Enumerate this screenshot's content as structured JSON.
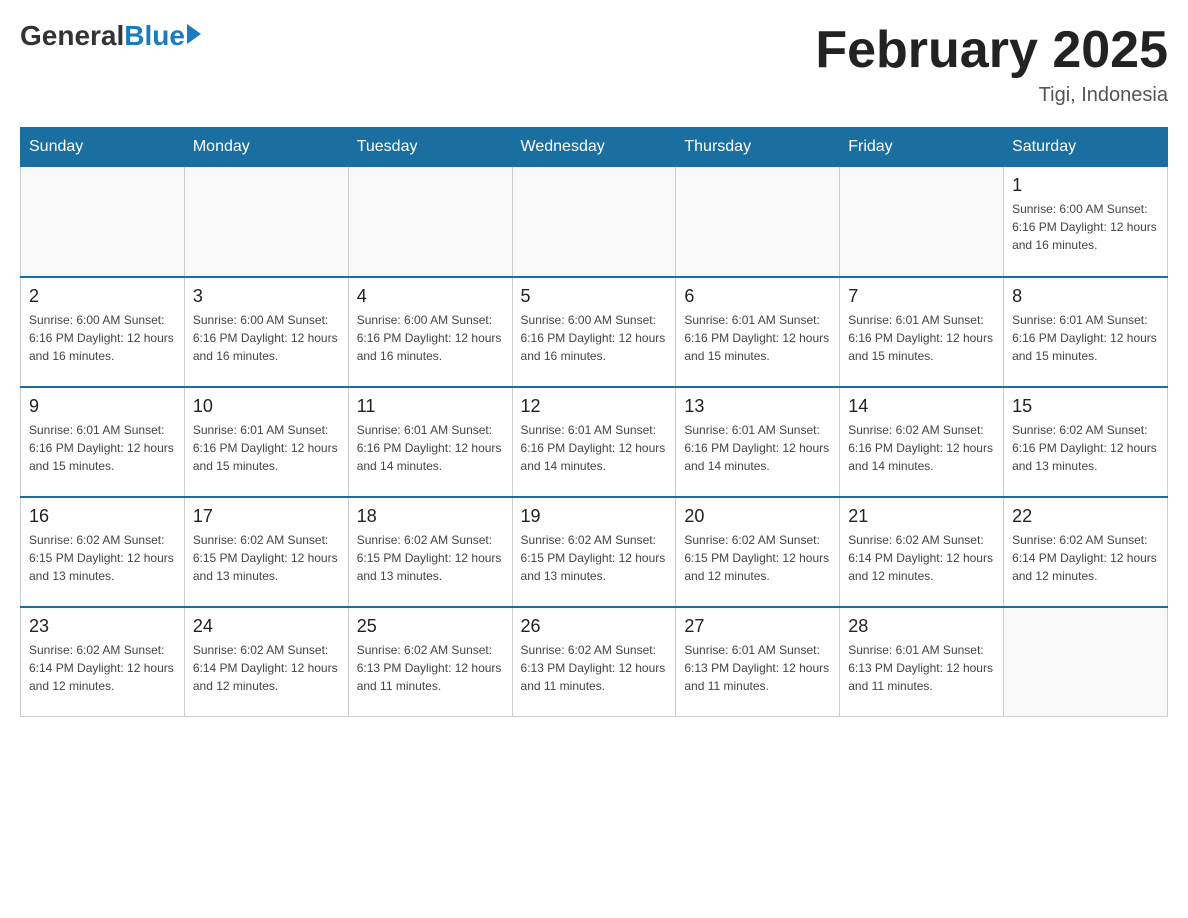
{
  "logo": {
    "general": "General",
    "blue": "Blue"
  },
  "title": "February 2025",
  "location": "Tigi, Indonesia",
  "weekdays": [
    "Sunday",
    "Monday",
    "Tuesday",
    "Wednesday",
    "Thursday",
    "Friday",
    "Saturday"
  ],
  "weeks": [
    [
      {
        "day": "",
        "info": ""
      },
      {
        "day": "",
        "info": ""
      },
      {
        "day": "",
        "info": ""
      },
      {
        "day": "",
        "info": ""
      },
      {
        "day": "",
        "info": ""
      },
      {
        "day": "",
        "info": ""
      },
      {
        "day": "1",
        "info": "Sunrise: 6:00 AM\nSunset: 6:16 PM\nDaylight: 12 hours\nand 16 minutes."
      }
    ],
    [
      {
        "day": "2",
        "info": "Sunrise: 6:00 AM\nSunset: 6:16 PM\nDaylight: 12 hours\nand 16 minutes."
      },
      {
        "day": "3",
        "info": "Sunrise: 6:00 AM\nSunset: 6:16 PM\nDaylight: 12 hours\nand 16 minutes."
      },
      {
        "day": "4",
        "info": "Sunrise: 6:00 AM\nSunset: 6:16 PM\nDaylight: 12 hours\nand 16 minutes."
      },
      {
        "day": "5",
        "info": "Sunrise: 6:00 AM\nSunset: 6:16 PM\nDaylight: 12 hours\nand 16 minutes."
      },
      {
        "day": "6",
        "info": "Sunrise: 6:01 AM\nSunset: 6:16 PM\nDaylight: 12 hours\nand 15 minutes."
      },
      {
        "day": "7",
        "info": "Sunrise: 6:01 AM\nSunset: 6:16 PM\nDaylight: 12 hours\nand 15 minutes."
      },
      {
        "day": "8",
        "info": "Sunrise: 6:01 AM\nSunset: 6:16 PM\nDaylight: 12 hours\nand 15 minutes."
      }
    ],
    [
      {
        "day": "9",
        "info": "Sunrise: 6:01 AM\nSunset: 6:16 PM\nDaylight: 12 hours\nand 15 minutes."
      },
      {
        "day": "10",
        "info": "Sunrise: 6:01 AM\nSunset: 6:16 PM\nDaylight: 12 hours\nand 15 minutes."
      },
      {
        "day": "11",
        "info": "Sunrise: 6:01 AM\nSunset: 6:16 PM\nDaylight: 12 hours\nand 14 minutes."
      },
      {
        "day": "12",
        "info": "Sunrise: 6:01 AM\nSunset: 6:16 PM\nDaylight: 12 hours\nand 14 minutes."
      },
      {
        "day": "13",
        "info": "Sunrise: 6:01 AM\nSunset: 6:16 PM\nDaylight: 12 hours\nand 14 minutes."
      },
      {
        "day": "14",
        "info": "Sunrise: 6:02 AM\nSunset: 6:16 PM\nDaylight: 12 hours\nand 14 minutes."
      },
      {
        "day": "15",
        "info": "Sunrise: 6:02 AM\nSunset: 6:16 PM\nDaylight: 12 hours\nand 13 minutes."
      }
    ],
    [
      {
        "day": "16",
        "info": "Sunrise: 6:02 AM\nSunset: 6:15 PM\nDaylight: 12 hours\nand 13 minutes."
      },
      {
        "day": "17",
        "info": "Sunrise: 6:02 AM\nSunset: 6:15 PM\nDaylight: 12 hours\nand 13 minutes."
      },
      {
        "day": "18",
        "info": "Sunrise: 6:02 AM\nSunset: 6:15 PM\nDaylight: 12 hours\nand 13 minutes."
      },
      {
        "day": "19",
        "info": "Sunrise: 6:02 AM\nSunset: 6:15 PM\nDaylight: 12 hours\nand 13 minutes."
      },
      {
        "day": "20",
        "info": "Sunrise: 6:02 AM\nSunset: 6:15 PM\nDaylight: 12 hours\nand 12 minutes."
      },
      {
        "day": "21",
        "info": "Sunrise: 6:02 AM\nSunset: 6:14 PM\nDaylight: 12 hours\nand 12 minutes."
      },
      {
        "day": "22",
        "info": "Sunrise: 6:02 AM\nSunset: 6:14 PM\nDaylight: 12 hours\nand 12 minutes."
      }
    ],
    [
      {
        "day": "23",
        "info": "Sunrise: 6:02 AM\nSunset: 6:14 PM\nDaylight: 12 hours\nand 12 minutes."
      },
      {
        "day": "24",
        "info": "Sunrise: 6:02 AM\nSunset: 6:14 PM\nDaylight: 12 hours\nand 12 minutes."
      },
      {
        "day": "25",
        "info": "Sunrise: 6:02 AM\nSunset: 6:13 PM\nDaylight: 12 hours\nand 11 minutes."
      },
      {
        "day": "26",
        "info": "Sunrise: 6:02 AM\nSunset: 6:13 PM\nDaylight: 12 hours\nand 11 minutes."
      },
      {
        "day": "27",
        "info": "Sunrise: 6:01 AM\nSunset: 6:13 PM\nDaylight: 12 hours\nand 11 minutes."
      },
      {
        "day": "28",
        "info": "Sunrise: 6:01 AM\nSunset: 6:13 PM\nDaylight: 12 hours\nand 11 minutes."
      },
      {
        "day": "",
        "info": ""
      }
    ]
  ]
}
